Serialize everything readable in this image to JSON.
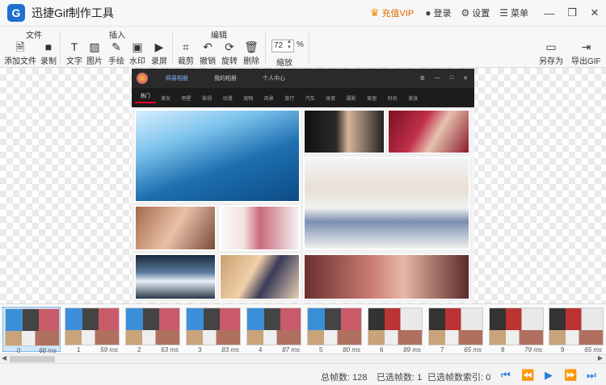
{
  "app": {
    "title": "迅捷Gif制作工具",
    "logo_letter": "G"
  },
  "titlebar": {
    "vip_label": "充值VIP",
    "login_label": "登录",
    "settings_label": "设置",
    "menu_label": "菜单",
    "icons": [
      "crown-icon",
      "user-icon",
      "gear-icon",
      "menu-icon",
      "minimize-icon",
      "restore-icon",
      "close-icon"
    ]
  },
  "ribbon": {
    "groups": {
      "file": "文件",
      "insert": "插入",
      "edit": "编辑"
    },
    "buttons": {
      "add_file": "添加文件",
      "record": "录制",
      "text": "文字",
      "image": "图片",
      "draw": "手绘",
      "watermark": "水印",
      "screen_record": "录屏",
      "crop": "裁剪",
      "undo": "撤销",
      "rotate": "旋转",
      "delete": "删除",
      "zoom": "缩放",
      "save_as": "另存为",
      "export_gif": "导出GIF"
    },
    "zoom_value": "72",
    "zoom_unit": "%"
  },
  "frame_preview": {
    "brand": "网易相册",
    "link1": "我的相册",
    "link2": "个人中心",
    "nav": [
      "热门",
      "美女",
      "明星",
      "影视",
      "动漫",
      "宠物",
      "风景",
      "旅行",
      "汽车",
      "体育",
      "摄影",
      "家居",
      "时尚",
      "美食"
    ]
  },
  "filmstrip": {
    "frames": [
      {
        "index": "0",
        "ms": "66 ms"
      },
      {
        "index": "1",
        "ms": "59 ms"
      },
      {
        "index": "2",
        "ms": "63 ms"
      },
      {
        "index": "3",
        "ms": "83 ms"
      },
      {
        "index": "4",
        "ms": "87 ms"
      },
      {
        "index": "5",
        "ms": "80 ms"
      },
      {
        "index": "6",
        "ms": "89 ms"
      },
      {
        "index": "7",
        "ms": "65 ms"
      },
      {
        "index": "8",
        "ms": "79 ms"
      },
      {
        "index": "9",
        "ms": "65 ms"
      }
    ]
  },
  "status": {
    "total_frames": "总帧数: 128",
    "selected_frames": "已选帧数: 1",
    "selected_index": "已选帧数索引: 0"
  },
  "colors": {
    "accent": "#2c7fe0",
    "vip": "#e26a00",
    "logo": "#1f6fd1"
  }
}
